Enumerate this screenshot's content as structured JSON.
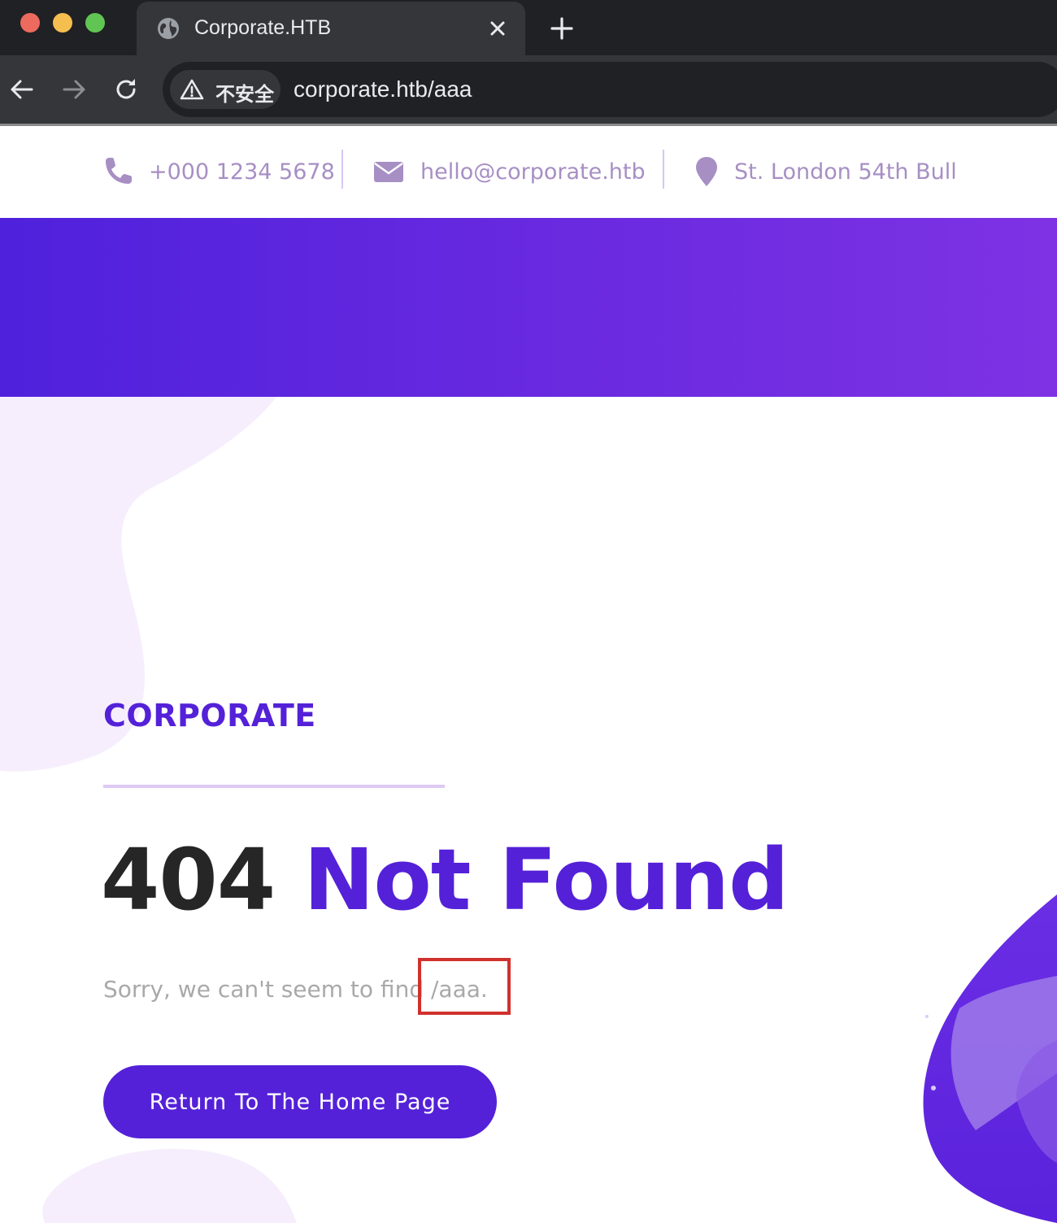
{
  "browser": {
    "tab_title": "Corporate.HTB",
    "security_label": "不安全",
    "url": "corporate.htb/aaa",
    "icons": {
      "favicon": "globe-icon",
      "close": "close-icon",
      "new_tab": "plus-icon",
      "back": "arrow-left-icon",
      "forward": "arrow-right-icon",
      "reload": "reload-icon",
      "security": "warning-triangle-icon"
    }
  },
  "contact": {
    "phone": "+000 1234 5678",
    "email": "hello@corporate.htb",
    "address": "St. London 54th Bull",
    "icon_color": "#a78fc4"
  },
  "page": {
    "brand": "CORPORATE",
    "error_code": "404",
    "error_message": "Not Found",
    "sorry_text": "Sorry, we can't seem to find /aaa.",
    "home_button": "Return To The Home Page"
  },
  "colors": {
    "accent": "#5421d8",
    "hero_start": "#4f21dc",
    "hero_end": "#7e32e4",
    "highlight": "#d0312d"
  }
}
